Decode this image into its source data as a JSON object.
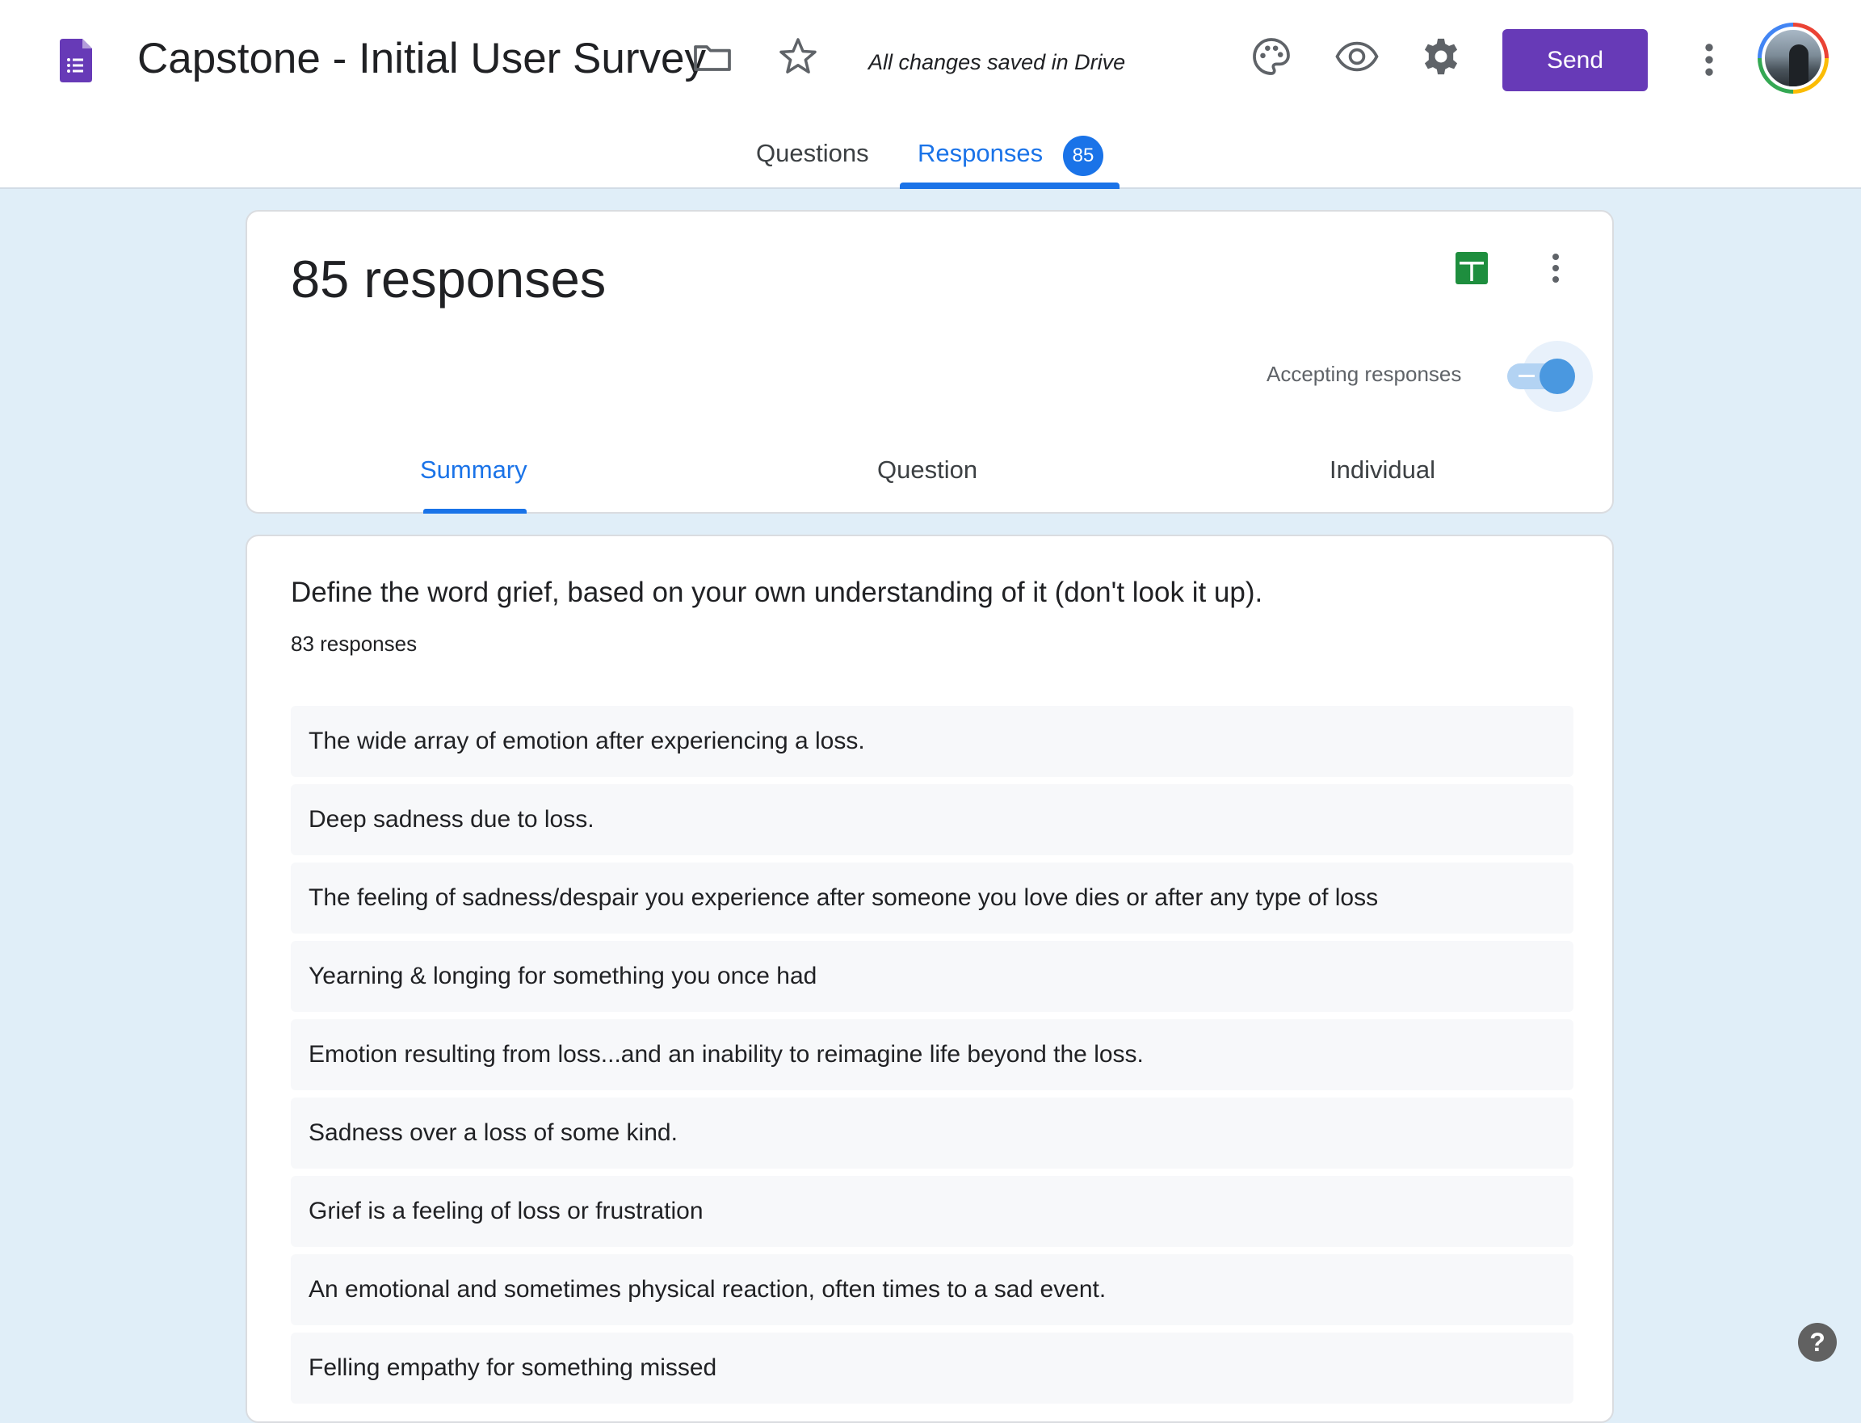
{
  "header": {
    "title": "Capstone - Initial User Survey",
    "save_status": "All changes saved in Drive",
    "send_label": "Send",
    "icons": [
      "forms-app-icon",
      "folder-icon",
      "star-icon",
      "palette-icon",
      "eye-icon",
      "gear-icon",
      "more-vert-icon",
      "avatar"
    ],
    "accent_color": "#673ab7"
  },
  "tabs": {
    "questions_label": "Questions",
    "responses_label": "Responses",
    "responses_badge": "85",
    "active": "Responses",
    "active_color": "#1a73e8"
  },
  "summary": {
    "title": "85 responses",
    "accepting_label": "Accepting responses",
    "accepting": true,
    "sub_tabs": {
      "summary": "Summary",
      "question": "Question",
      "individual": "Individual",
      "active": "Summary"
    }
  },
  "question": {
    "title": "Define the word grief, based on your own understanding of it (don't look it up).",
    "count": "83 responses",
    "answers": [
      "The wide array of emotion after experiencing a loss.",
      "Deep sadness due to loss.",
      "The feeling of sadness/despair you experience after someone you love dies or after any type of loss",
      "Yearning & longing for something you once had",
      "Emotion resulting from loss...and an inability to reimagine life beyond the loss.",
      "Sadness over a loss of some kind.",
      "Grief is a feeling of loss or frustration",
      "An emotional and sometimes physical reaction, often times to a sad event.",
      "Felling empathy for something missed"
    ]
  },
  "help": {
    "label": "?"
  }
}
